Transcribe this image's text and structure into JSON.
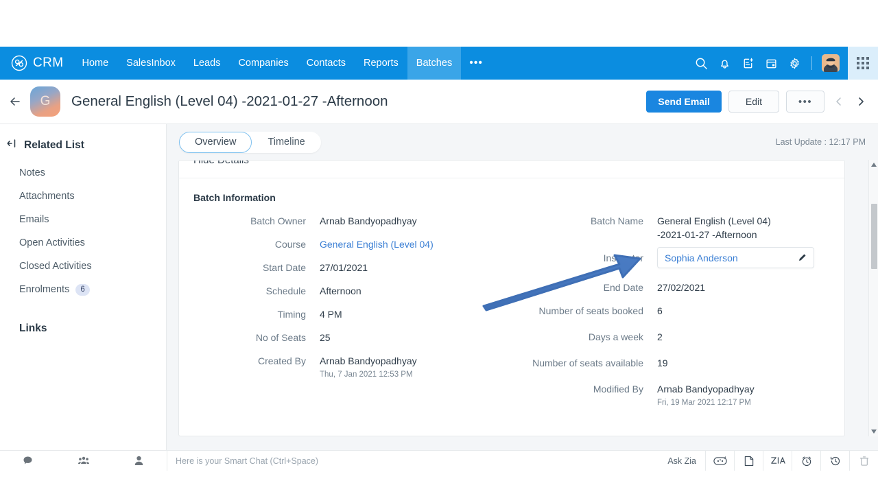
{
  "nav": {
    "brand": "CRM",
    "items": [
      {
        "label": "Home",
        "active": false
      },
      {
        "label": "SalesInbox",
        "active": false
      },
      {
        "label": "Leads",
        "active": false
      },
      {
        "label": "Companies",
        "active": false
      },
      {
        "label": "Contacts",
        "active": false
      },
      {
        "label": "Reports",
        "active": false
      },
      {
        "label": "Batches",
        "active": true
      }
    ],
    "more_label": "•••",
    "icons": [
      "search-icon",
      "bell-icon",
      "add-note-icon",
      "calendar-icon",
      "gear-icon"
    ],
    "accent_color": "#0b8de0",
    "active_tab_color": "#3aa5e8"
  },
  "record": {
    "avatar_initial": "G",
    "title": "General English (Level 04) -2021-01-27 -Afternoon",
    "send_email_label": "Send Email",
    "edit_label": "Edit",
    "more_label": "•••"
  },
  "sidebar": {
    "title": "Related List",
    "items": [
      {
        "label": "Notes",
        "badge": ""
      },
      {
        "label": "Attachments",
        "badge": ""
      },
      {
        "label": "Emails",
        "badge": ""
      },
      {
        "label": "Open Activities",
        "badge": ""
      },
      {
        "label": "Closed Activities",
        "badge": ""
      },
      {
        "label": "Enrolments",
        "badge": "6"
      }
    ],
    "links_label": "Links"
  },
  "main": {
    "tabs": [
      {
        "label": "Overview",
        "active": true
      },
      {
        "label": "Timeline",
        "active": false
      }
    ],
    "last_update": "Last Update : 12:17 PM",
    "hide_details_label": "Hide Details",
    "section_title": "Batch Information",
    "left_fields": [
      {
        "label": "Batch Owner",
        "value": "Arnab Bandyopadhyay",
        "sub": "",
        "link": false
      },
      {
        "label": "Course",
        "value": "General English (Level 04)",
        "sub": "",
        "link": true
      },
      {
        "label": "Start Date",
        "value": "27/01/2021",
        "sub": "",
        "link": false
      },
      {
        "label": "Schedule",
        "value": "Afternoon",
        "sub": "",
        "link": false
      },
      {
        "label": "Timing",
        "value": "4 PM",
        "sub": "",
        "link": false
      },
      {
        "label": "No of Seats",
        "value": "25",
        "sub": "",
        "link": false
      },
      {
        "label": "Created By",
        "value": "Arnab Bandyopadhyay",
        "sub": "Thu, 7 Jan 2021 12:53 PM",
        "link": false
      }
    ],
    "right_fields": [
      {
        "label": "Batch Name",
        "value": "General English (Level 04) -2021-01-27 -Afternoon",
        "sub": "",
        "link": false
      },
      {
        "label": "End Date",
        "value": "27/02/2021",
        "sub": "",
        "link": false
      },
      {
        "label": "Number of seats booked",
        "value": "6",
        "sub": "",
        "link": false
      },
      {
        "label": "Days a week",
        "value": "2",
        "sub": "",
        "link": false
      },
      {
        "label": "Number of seats available",
        "value": "19",
        "sub": "",
        "link": false
      },
      {
        "label": "Modified By",
        "value": "Arnab Bandyopadhyay",
        "sub": "Fri, 19 Mar 2021 12:17 PM",
        "link": false
      }
    ],
    "instructor": {
      "label": "Instructor",
      "value": "Sophia Anderson",
      "link_color": "#3b7fd4"
    }
  },
  "bottom": {
    "chat_placeholder": "Here is your Smart Chat (Ctrl+Space)",
    "ask_zia_label": "Ask Zia",
    "left_icons": [
      "chat-bubble-icon",
      "group-icon",
      "person-icon"
    ],
    "right_icons": [
      "zia-robot-icon",
      "notes-icon",
      "zia-logo-icon",
      "alarm-clock-icon",
      "history-icon",
      "trash-icon"
    ]
  }
}
